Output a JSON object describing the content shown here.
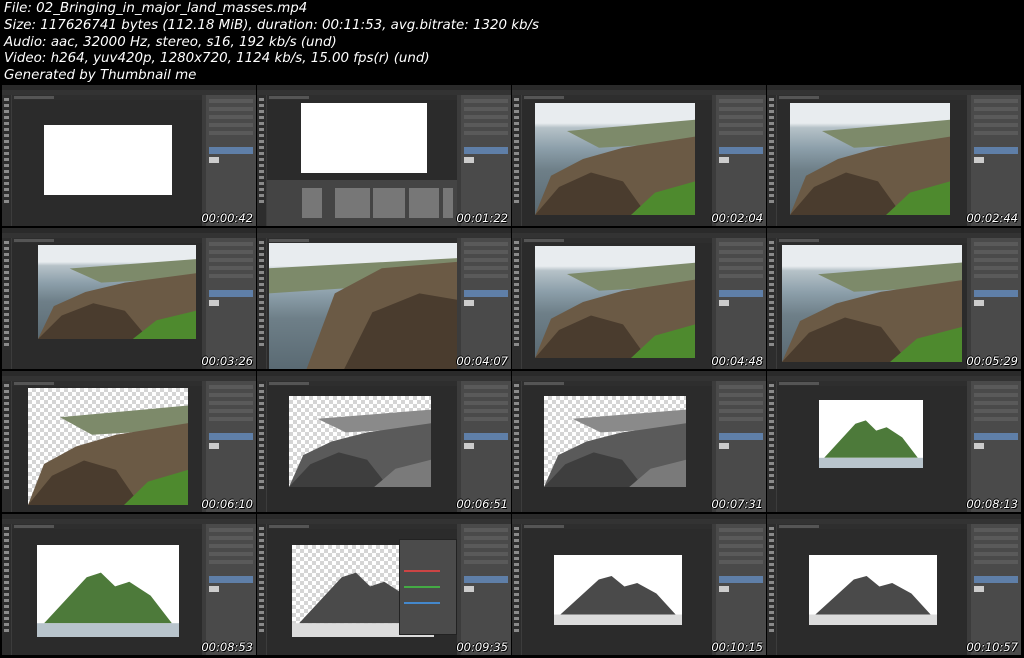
{
  "header": {
    "line1": "File: 02_Bringing_in_major_land_masses.mp4",
    "line2": "Size: 117626741 bytes (112.18 MiB), duration: 00:11:53, avg.bitrate: 1320 kb/s",
    "line3": "Audio: aac, 32000 Hz, stereo, s16, 192 kb/s (und)",
    "line4": "Video: h264, yuv420p, 1280x720, 1124 kb/s, 15.00 fps(r) (und)",
    "line5": "Generated by Thumbnail me"
  },
  "thumbnails": [
    {
      "timestamp": "00:00:42",
      "content": "white-canvas"
    },
    {
      "timestamp": "00:01:22",
      "content": "white-canvas-filmstrip"
    },
    {
      "timestamp": "00:02:04",
      "content": "coastal-cliff"
    },
    {
      "timestamp": "00:02:44",
      "content": "coastal-cliff"
    },
    {
      "timestamp": "00:03:26",
      "content": "coastal-cliff-crop"
    },
    {
      "timestamp": "00:04:07",
      "content": "coastal-cliff-zoom"
    },
    {
      "timestamp": "00:04:48",
      "content": "coastal-cliff"
    },
    {
      "timestamp": "00:05:29",
      "content": "coastal-cliff-wide"
    },
    {
      "timestamp": "00:06:10",
      "content": "cliff-transparent"
    },
    {
      "timestamp": "00:06:51",
      "content": "cliff-grayscale-transparent"
    },
    {
      "timestamp": "00:07:31",
      "content": "cliff-grayscale-transparent"
    },
    {
      "timestamp": "00:08:13",
      "content": "island"
    },
    {
      "timestamp": "00:08:53",
      "content": "island-large"
    },
    {
      "timestamp": "00:09:35",
      "content": "island-grayscale-curves"
    },
    {
      "timestamp": "00:10:15",
      "content": "island-grayscale-transform"
    },
    {
      "timestamp": "00:10:57",
      "content": "island-grayscale-composite"
    }
  ]
}
